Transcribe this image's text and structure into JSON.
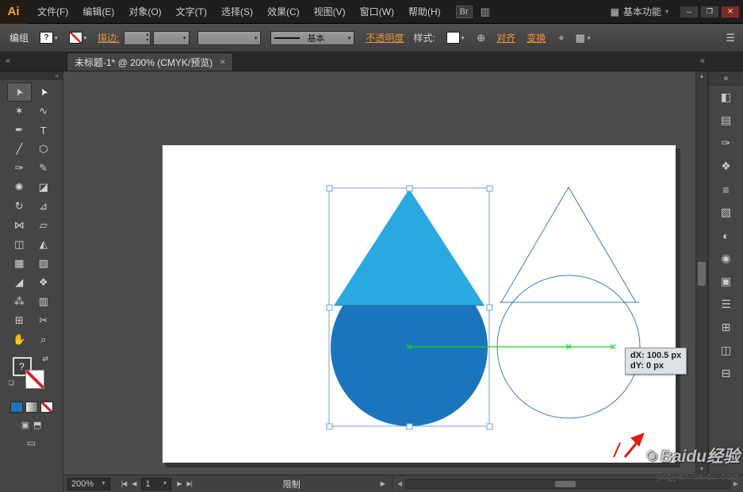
{
  "glyphs": {
    "caret_down": "▼",
    "caret_small": "▾",
    "stepper_up": "▴",
    "stepper_down": "▾",
    "left_arrow": "◀",
    "right_arrow": "▶",
    "up_arrow": "▲",
    "down_arrow": "▼",
    "collapse_left": "«",
    "collapse_right": "»",
    "swap": "⇄",
    "mini_default": "❏"
  },
  "menubar": {
    "logo": "Ai",
    "items": [
      "文件(F)",
      "编辑(E)",
      "对象(O)",
      "文字(T)",
      "选择(S)",
      "效果(C)",
      "视图(V)",
      "窗口(W)",
      "帮助(H)"
    ],
    "bridge_label": "Br",
    "arrange_icon": "▥",
    "workspace_icon": "▦",
    "workspace_label": "基本功能",
    "window_buttons": {
      "minimize": "─",
      "maximize": "❐",
      "close": "✕"
    }
  },
  "controlbar": {
    "context_label": "编组",
    "fill_indicator": "?",
    "stroke_label": "描边:",
    "brush_label": "基本",
    "opacity_label": "不透明度",
    "style_label": "样式:",
    "globe_icon": "⊕",
    "align_label": "对齐",
    "transform_label": "变换",
    "isolate_icon": "⌖",
    "similar_icon": "▩",
    "panel_menu_icon": "☰"
  },
  "tabbar": {
    "title": "未标题-1* @ 200% (CMYK/预览)",
    "close": "×"
  },
  "toolbar": {
    "tools": [
      {
        "name": "selection-tool",
        "glyph": "➤"
      },
      {
        "name": "direct-selection-tool",
        "glyph": "➤"
      },
      {
        "name": "magic-wand-tool",
        "glyph": "✶"
      },
      {
        "name": "lasso-tool",
        "glyph": "∿"
      },
      {
        "name": "pen-tool",
        "glyph": "✒"
      },
      {
        "name": "type-tool",
        "glyph": "T"
      },
      {
        "name": "line-segment-tool",
        "glyph": "╱"
      },
      {
        "name": "shape-tool",
        "glyph": "⬡"
      },
      {
        "name": "paintbrush-tool",
        "glyph": "✑"
      },
      {
        "name": "pencil-tool",
        "glyph": "✎"
      },
      {
        "name": "blob-brush-tool",
        "glyph": "✺"
      },
      {
        "name": "eraser-tool",
        "glyph": "◪"
      },
      {
        "name": "rotate-tool",
        "glyph": "↻"
      },
      {
        "name": "scale-tool",
        "glyph": "⊿"
      },
      {
        "name": "width-tool",
        "glyph": "⋈"
      },
      {
        "name": "free-transform-tool",
        "glyph": "▱"
      },
      {
        "name": "shape-builder-tool",
        "glyph": "◫"
      },
      {
        "name": "perspective-grid-tool",
        "glyph": "◭"
      },
      {
        "name": "mesh-tool",
        "glyph": "▦"
      },
      {
        "name": "gradient-tool",
        "glyph": "▧"
      },
      {
        "name": "eyedropper-tool",
        "glyph": "◢"
      },
      {
        "name": "blend-tool",
        "glyph": "❖"
      },
      {
        "name": "symbol-sprayer-tool",
        "glyph": "⁂"
      },
      {
        "name": "column-graph-tool",
        "glyph": "▥"
      },
      {
        "name": "artboard-tool",
        "glyph": "⊞"
      },
      {
        "name": "slice-tool",
        "glyph": "✂"
      },
      {
        "name": "hand-tool",
        "glyph": "✋"
      },
      {
        "name": "zoom-tool",
        "glyph": "⌕"
      }
    ],
    "fill_indicator": "?",
    "mode_buttons": {
      "draw_normal": "▣",
      "draw_behind": "⬒"
    },
    "screen_mode": "▭"
  },
  "right_dock": {
    "expand_icon": "«",
    "icons": [
      {
        "name": "color-panel-icon",
        "glyph": "◧"
      },
      {
        "name": "swatches-panel-icon",
        "glyph": "▤"
      },
      {
        "name": "brushes-panel-icon",
        "glyph": "✑"
      },
      {
        "name": "symbols-panel-icon",
        "glyph": "❖"
      },
      {
        "name": "stroke-panel-icon",
        "glyph": "≡"
      },
      {
        "name": "gradient-panel-icon",
        "glyph": "▧"
      },
      {
        "name": "transparency-panel-icon",
        "glyph": "◐"
      },
      {
        "name": "appearance-panel-icon",
        "glyph": "◉"
      },
      {
        "name": "graphic-styles-panel-icon",
        "glyph": "▣"
      },
      {
        "name": "layers-panel-icon",
        "glyph": "☰"
      },
      {
        "name": "artboards-panel-icon",
        "glyph": "⊞"
      },
      {
        "name": "pathfinder-panel-icon",
        "glyph": "◫"
      },
      {
        "name": "align-panel-icon",
        "glyph": "⊟"
      }
    ]
  },
  "canvas": {
    "tooltip": {
      "line1": "dX: 100.5 px",
      "line2": "dY: 0 px"
    },
    "colors": {
      "artboard": "#ffffff",
      "drop_top": "#2aa9e0",
      "drop_body": "#1b75bc",
      "outline": "#3a7cc0",
      "selection": "#6aa3dc",
      "guide": "#1ccf1c",
      "cursor": "#e01b12"
    }
  },
  "statusbar": {
    "zoom": "200%",
    "nav": {
      "first": "|◀",
      "prev": "◀",
      "next": "▶",
      "last": "▶|"
    },
    "artboard": "1",
    "status": "限制"
  },
  "watermark": {
    "logo": "◉",
    "brand": "Baidu经验",
    "url": "jingyan.baidu.com"
  }
}
